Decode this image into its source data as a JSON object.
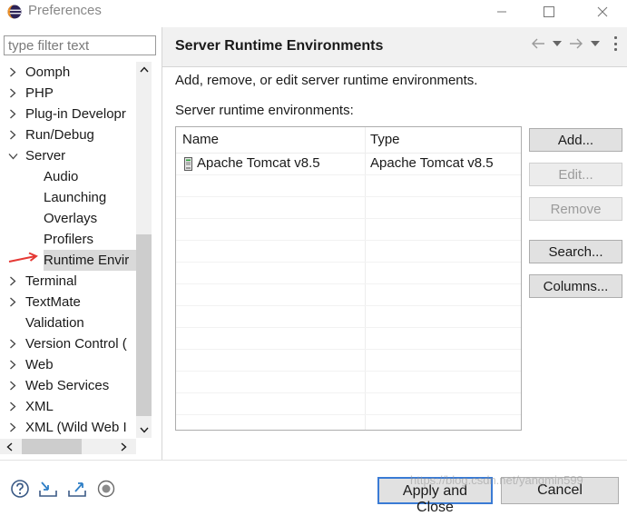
{
  "window": {
    "title": "Preferences",
    "icon": "eclipse-icon",
    "controls": [
      "minimize-icon",
      "maximize-icon",
      "close-icon"
    ]
  },
  "filter": {
    "placeholder": "type filter text",
    "value": ""
  },
  "tree": {
    "items": [
      {
        "label": "Oomph",
        "level": 0,
        "expander": "collapsed"
      },
      {
        "label": "PHP",
        "level": 0,
        "expander": "collapsed"
      },
      {
        "label": "Plug-in Developr",
        "level": 0,
        "expander": "collapsed"
      },
      {
        "label": "Run/Debug",
        "level": 0,
        "expander": "collapsed"
      },
      {
        "label": "Server",
        "level": 0,
        "expander": "expanded"
      },
      {
        "label": "Audio",
        "level": 1,
        "expander": "none"
      },
      {
        "label": "Launching",
        "level": 1,
        "expander": "none"
      },
      {
        "label": "Overlays",
        "level": 1,
        "expander": "none"
      },
      {
        "label": "Profilers",
        "level": 1,
        "expander": "none"
      },
      {
        "label": "Runtime Envir",
        "level": 1,
        "expander": "none",
        "selected": true
      },
      {
        "label": "Terminal",
        "level": 0,
        "expander": "collapsed"
      },
      {
        "label": "TextMate",
        "level": 0,
        "expander": "collapsed"
      },
      {
        "label": "Validation",
        "level": 0,
        "expander": "none"
      },
      {
        "label": "Version Control (",
        "level": 0,
        "expander": "collapsed"
      },
      {
        "label": "Web",
        "level": 0,
        "expander": "collapsed"
      },
      {
        "label": "Web Services",
        "level": 0,
        "expander": "collapsed"
      },
      {
        "label": "XML",
        "level": 0,
        "expander": "collapsed"
      },
      {
        "label": "XML (Wild Web I",
        "level": 0,
        "expander": "collapsed"
      }
    ]
  },
  "page": {
    "title": "Server Runtime Environments",
    "description": "Add, remove, or edit server runtime environments.",
    "table_caption": "Server runtime environments:",
    "nav_icons": [
      "back-arrow-icon",
      "dropdown-icon",
      "forward-arrow-icon",
      "dropdown-icon",
      "view-menu-icon"
    ]
  },
  "runtime_table": {
    "columns": [
      "Name",
      "Type"
    ],
    "rows": [
      {
        "name": "Apache Tomcat v8.5",
        "type": "Apache Tomcat v8.5",
        "icon": "server-icon"
      }
    ]
  },
  "buttons": {
    "add": "Add...",
    "edit": "Edit...",
    "remove": "Remove",
    "search": "Search...",
    "columns": "Columns..."
  },
  "footer": {
    "icons": [
      "help-icon",
      "import-icon",
      "export-icon",
      "record-icon"
    ],
    "apply_and_close": "Apply and Close",
    "cancel": "Cancel"
  },
  "watermark": "https://blog.csdn.net/yangmin599",
  "colors": {
    "selection": "#d9d9d9",
    "header_bg": "#f1f1f1",
    "default_button_border": "#3a7bd5",
    "annotation_arrow": "#e53935"
  }
}
